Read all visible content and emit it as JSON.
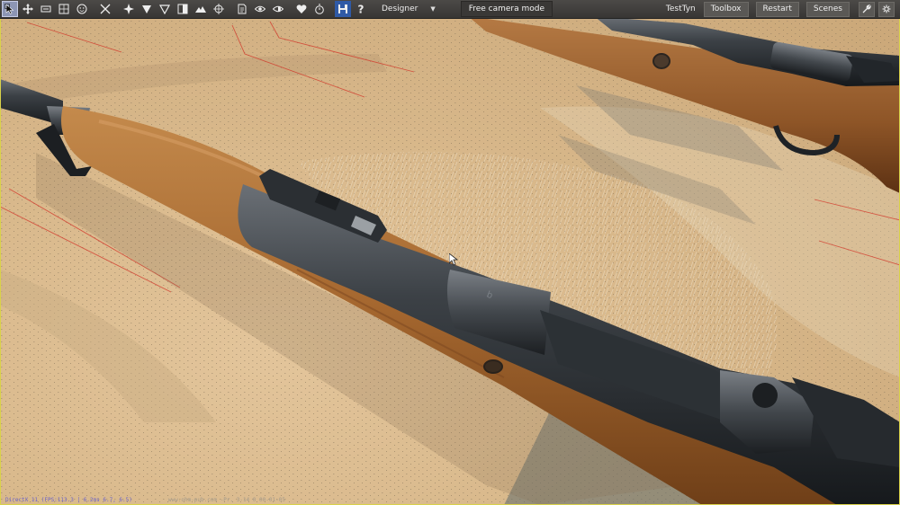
{
  "toolbar": {
    "tools": [
      {
        "name": "select-tool",
        "icon": "cursor-icon",
        "active": true
      },
      {
        "name": "move-tool",
        "icon": "move-arrows-icon"
      },
      {
        "name": "scale-tool",
        "icon": "scale-icon"
      },
      {
        "name": "snap-tool",
        "icon": "snap-grid-icon"
      },
      {
        "name": "toggle-tool",
        "icon": "smiley-icon"
      },
      {
        "name": "cut-tool",
        "icon": "scissors-icon"
      },
      {
        "name": "pivot-tool",
        "icon": "pivot-icon"
      },
      {
        "name": "filter-down-tool",
        "icon": "triangle-filled-icon"
      },
      {
        "name": "filter-outline-tool",
        "icon": "triangle-outline-icon"
      },
      {
        "name": "split-tool",
        "icon": "split-view-icon"
      },
      {
        "name": "terrain-tool",
        "icon": "terrain-icon"
      },
      {
        "name": "target-tool",
        "icon": "crosshair-icon"
      },
      {
        "name": "document-tool",
        "icon": "document-icon"
      },
      {
        "name": "eye-tool",
        "icon": "eye-icon"
      },
      {
        "name": "visibility-tool",
        "icon": "eye-half-icon"
      },
      {
        "name": "favorite-tool",
        "icon": "heart-icon"
      },
      {
        "name": "timer-tool",
        "icon": "stopwatch-icon"
      },
      {
        "name": "save-tool",
        "icon": "floppy-icon"
      },
      {
        "name": "help-tool",
        "icon": "question-icon"
      }
    ],
    "mode_dropdown": "Designer",
    "camera_mode": "Free camera mode",
    "user": "TestTyn",
    "toolbox": "Toolbox",
    "restart": "Restart",
    "scenes": "Scenes"
  },
  "status": {
    "renderer": "DirectX 11 (FPS:113.3 | 6.2ms 6.7, 6.5)",
    "info": "www.ohm-pub.com   -Pr. 3-14 0 00-01-05"
  }
}
